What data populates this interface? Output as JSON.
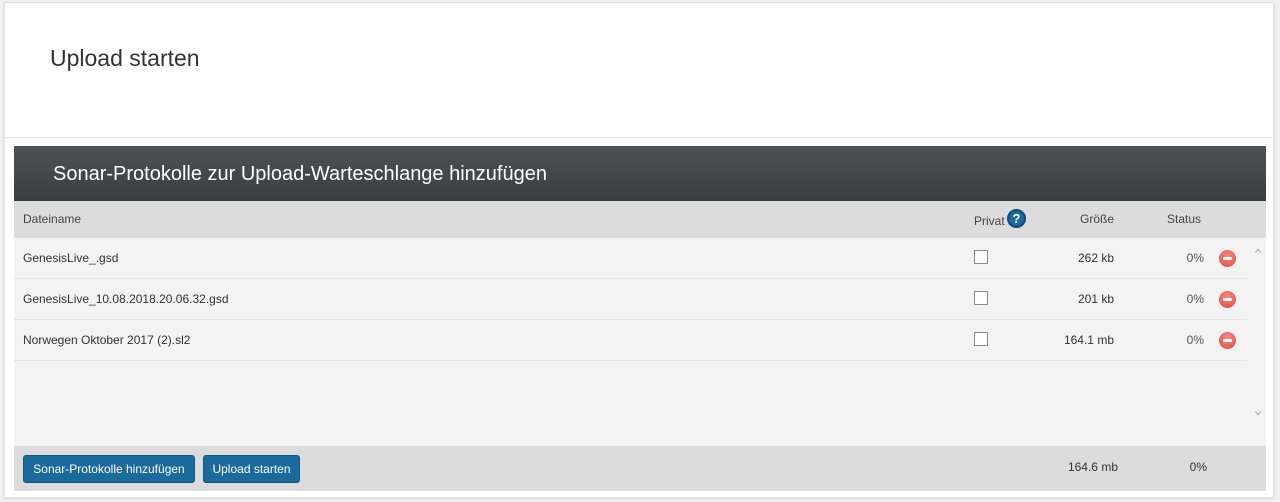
{
  "page": {
    "title": "Upload starten"
  },
  "panel": {
    "title": "Sonar-Protokolle zur Upload-Warteschlange hinzufügen",
    "columns": {
      "filename": "Dateiname",
      "private": "Privat",
      "size": "Größe",
      "status": "Status"
    },
    "help_glyph": "?",
    "files": [
      {
        "name": "GenesisLive_.gsd",
        "private": false,
        "size": "262 kb",
        "status": "0%"
      },
      {
        "name": "GenesisLive_10.08.2018.20.06.32.gsd",
        "private": false,
        "size": "201 kb",
        "status": "0%"
      },
      {
        "name": "Norwegen Oktober 2017 (2).sl2",
        "private": false,
        "size": "164.1 mb",
        "status": "0%"
      }
    ],
    "footer": {
      "add_button": "Sonar-Protokolle hinzufügen",
      "upload_button": "Upload starten",
      "total_size": "164.6 mb",
      "total_status": "0%"
    }
  },
  "icons": {
    "help": "question-circle-icon",
    "remove": "minus-circle-icon",
    "scroll_up": "chevron-up-icon",
    "scroll_down": "chevron-down-icon"
  },
  "colors": {
    "header_bg": "#3f4247",
    "button_bg": "#1a6a9c",
    "remove_red": "#e8554b"
  }
}
